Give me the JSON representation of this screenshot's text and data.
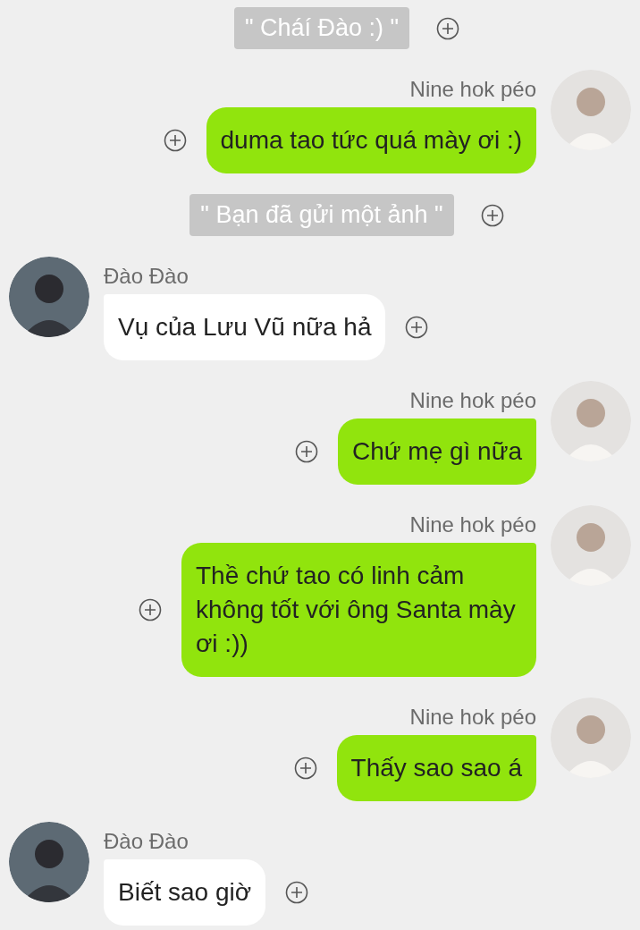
{
  "messages": [
    {
      "kind": "system",
      "text": "\" Cháí Đào :) \""
    },
    {
      "kind": "message",
      "outgoing": true,
      "sender": "Nine hok péo",
      "text": "duma tao tức quá mày ơi :)"
    },
    {
      "kind": "system",
      "text": "\" Bạn đã gửi một ảnh \""
    },
    {
      "kind": "message",
      "outgoing": false,
      "sender": "Đào Đào",
      "text": "Vụ của Lưu Vũ nữa hả"
    },
    {
      "kind": "message",
      "outgoing": true,
      "sender": "Nine hok péo",
      "text": "Chứ mẹ gì nữa"
    },
    {
      "kind": "message",
      "outgoing": true,
      "sender": "Nine hok péo",
      "text": "Thề chứ tao có linh cảm không tốt với ông Santa mày ơi :))"
    },
    {
      "kind": "message",
      "outgoing": true,
      "sender": "Nine hok péo",
      "text": "Thấy sao sao á"
    },
    {
      "kind": "message",
      "outgoing": false,
      "sender": "Đào Đào",
      "text": "Biết sao giờ"
    }
  ]
}
